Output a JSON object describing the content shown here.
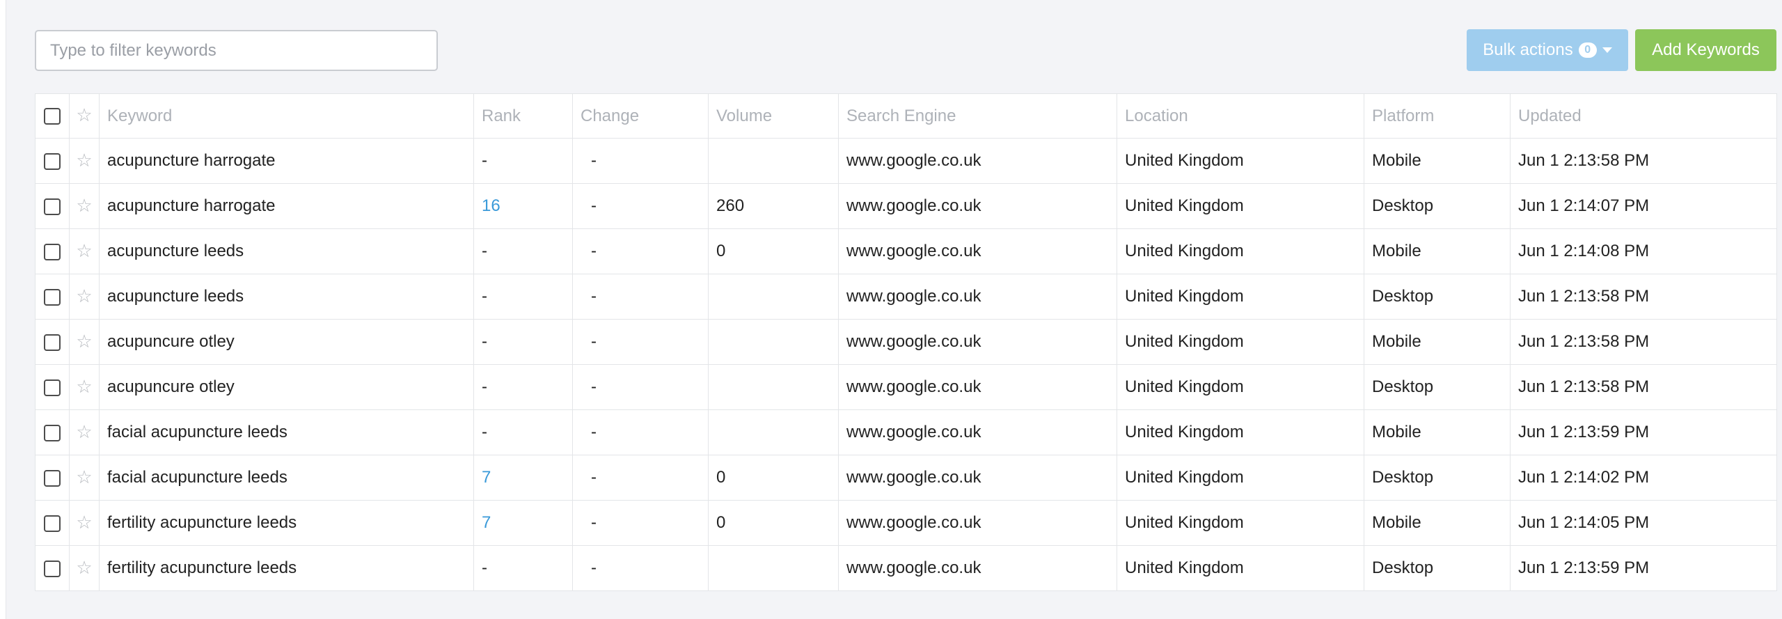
{
  "filter": {
    "placeholder": "Type to filter keywords",
    "value": ""
  },
  "bulk_actions": {
    "label": "Bulk actions",
    "count": "0"
  },
  "add_keywords": {
    "label": "Add Keywords"
  },
  "columns": [
    "Keyword",
    "Rank",
    "Change",
    "Volume",
    "Search Engine",
    "Location",
    "Platform",
    "Updated"
  ],
  "rows": [
    {
      "keyword": "acupuncture harrogate",
      "rank": "-",
      "change": "-",
      "volume": "",
      "engine": "www.google.co.uk",
      "location": "United Kingdom",
      "platform": "Mobile",
      "updated": "Jun 1 2:13:58 PM"
    },
    {
      "keyword": "acupuncture harrogate",
      "rank": "16",
      "change": "-",
      "volume": "260",
      "engine": "www.google.co.uk",
      "location": "United Kingdom",
      "platform": "Desktop",
      "updated": "Jun 1 2:14:07 PM"
    },
    {
      "keyword": "acupuncture leeds",
      "rank": "-",
      "change": "-",
      "volume": "0",
      "engine": "www.google.co.uk",
      "location": "United Kingdom",
      "platform": "Mobile",
      "updated": "Jun 1 2:14:08 PM"
    },
    {
      "keyword": "acupuncture leeds",
      "rank": "-",
      "change": "-",
      "volume": "",
      "engine": "www.google.co.uk",
      "location": "United Kingdom",
      "platform": "Desktop",
      "updated": "Jun 1 2:13:58 PM"
    },
    {
      "keyword": "acupuncure otley",
      "rank": "-",
      "change": "-",
      "volume": "",
      "engine": "www.google.co.uk",
      "location": "United Kingdom",
      "platform": "Mobile",
      "updated": "Jun 1 2:13:58 PM"
    },
    {
      "keyword": "acupuncure otley",
      "rank": "-",
      "change": "-",
      "volume": "",
      "engine": "www.google.co.uk",
      "location": "United Kingdom",
      "platform": "Desktop",
      "updated": "Jun 1 2:13:58 PM"
    },
    {
      "keyword": "facial acupuncture leeds",
      "rank": "-",
      "change": "-",
      "volume": "",
      "engine": "www.google.co.uk",
      "location": "United Kingdom",
      "platform": "Mobile",
      "updated": "Jun 1 2:13:59 PM"
    },
    {
      "keyword": "facial acupuncture leeds",
      "rank": "7",
      "change": "-",
      "volume": "0",
      "engine": "www.google.co.uk",
      "location": "United Kingdom",
      "platform": "Desktop",
      "updated": "Jun 1 2:14:02 PM"
    },
    {
      "keyword": "fertility acupuncture leeds",
      "rank": "7",
      "change": "-",
      "volume": "0",
      "engine": "www.google.co.uk",
      "location": "United Kingdom",
      "platform": "Mobile",
      "updated": "Jun 1 2:14:05 PM"
    },
    {
      "keyword": "fertility acupuncture leeds",
      "rank": "-",
      "change": "-",
      "volume": "",
      "engine": "www.google.co.uk",
      "location": "United Kingdom",
      "platform": "Desktop",
      "updated": "Jun 1 2:13:59 PM"
    }
  ],
  "colors": {
    "rank_link": "#3a9ad9",
    "bulk_button": "#9fcdee",
    "add_button": "#8cc65a",
    "background": "#f3f4f7"
  },
  "icons": {
    "row_star": "star-icon",
    "bulk_caret": "caret-down-icon"
  }
}
